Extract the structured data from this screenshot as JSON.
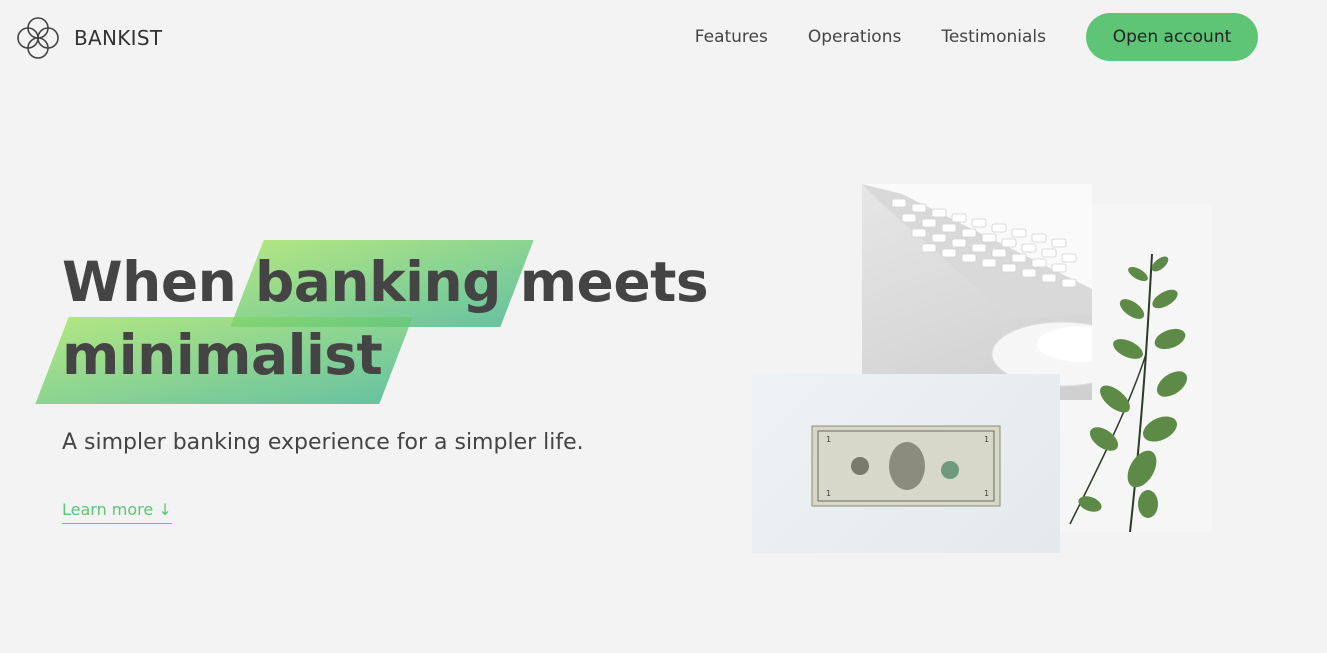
{
  "brand": {
    "name": "BANKIST",
    "logo_icon": "bankist-logo-icon"
  },
  "nav": {
    "links": [
      "Features",
      "Operations",
      "Testimonials"
    ],
    "cta": "Open account"
  },
  "hero": {
    "title_part1": "When",
    "title_highlight1": "banking",
    "title_part2": "meets",
    "title_highlight2": "minimalist",
    "subtitle": "A simpler banking experience for a simpler life.",
    "learn_more": "Learn more ↓"
  },
  "images": {
    "keyboard": "keyboard-and-mouse-photo",
    "money": "dollar-bill-photo",
    "plant": "eucalyptus-plant-photo"
  },
  "colors": {
    "accent": "#5ec576",
    "background": "#f3f3f3",
    "gradient_start": "#9be15d",
    "gradient_end": "#39b385"
  }
}
